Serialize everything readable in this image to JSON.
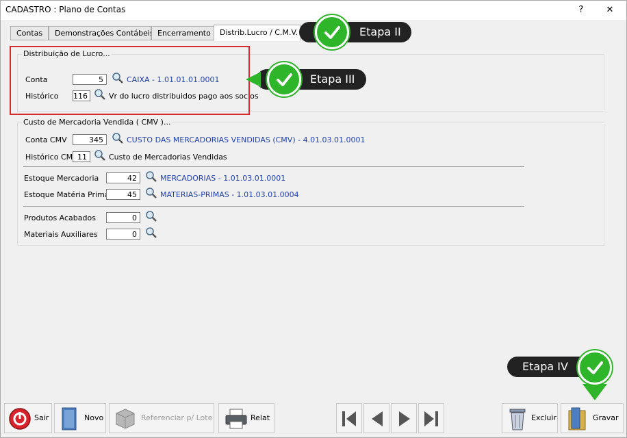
{
  "window": {
    "title": "CADASTRO : Plano de Contas",
    "help_glyph": "?",
    "close_glyph": "✕"
  },
  "tabs": [
    {
      "label": "Contas"
    },
    {
      "label": "Demonstrações Contábeis"
    },
    {
      "label": "Encerramento"
    },
    {
      "label": "Distrib.Lucro / C.M.V."
    }
  ],
  "distribuicao": {
    "legend": "Distribuição de Lucro...",
    "conta": {
      "label": "Conta",
      "value": "5",
      "desc": "CAIXA - 1.01.01.01.0001"
    },
    "historico": {
      "label": "Histórico",
      "value": "116",
      "desc": "Vr do lucro distribuidos pago aos socios"
    }
  },
  "cmv": {
    "legend": "Custo de Mercadoria Vendida ( CMV )...",
    "conta": {
      "label": "Conta CMV",
      "value": "345",
      "desc": "CUSTO DAS MERCADORIAS VENDIDAS (CMV) - 4.01.03.01.0001"
    },
    "historico": {
      "label": "Histórico CMV",
      "value": "11",
      "desc": "Custo de Mercadorias Vendidas"
    },
    "estoque_mercadoria": {
      "label": "Estoque Mercadoria",
      "value": "42",
      "desc": "MERCADORIAS - 1.01.03.01.0001"
    },
    "estoque_materia": {
      "label": "Estoque Matéria Prima",
      "value": "45",
      "desc": "MATERIAS-PRIMAS - 1.01.03.01.0004"
    },
    "produtos_acabados": {
      "label": "Produtos Acabados",
      "value": "0"
    },
    "materiais_auxiliares": {
      "label": "Materiais Auxiliares",
      "value": "0"
    }
  },
  "callouts": {
    "etapa2": "Etapa II",
    "etapa3": "Etapa III",
    "etapa4": "Etapa IV"
  },
  "toolbar": {
    "sair": "Sair",
    "novo": "Novo",
    "referenciar": "Referenciar p/ Lote",
    "relat": "Relat",
    "excluir": "Excluir",
    "gravar": "Gravar"
  },
  "colors": {
    "accent_green": "#2fb52a",
    "highlight_red": "#d62c2c",
    "link_blue": "#1f3fb0"
  }
}
